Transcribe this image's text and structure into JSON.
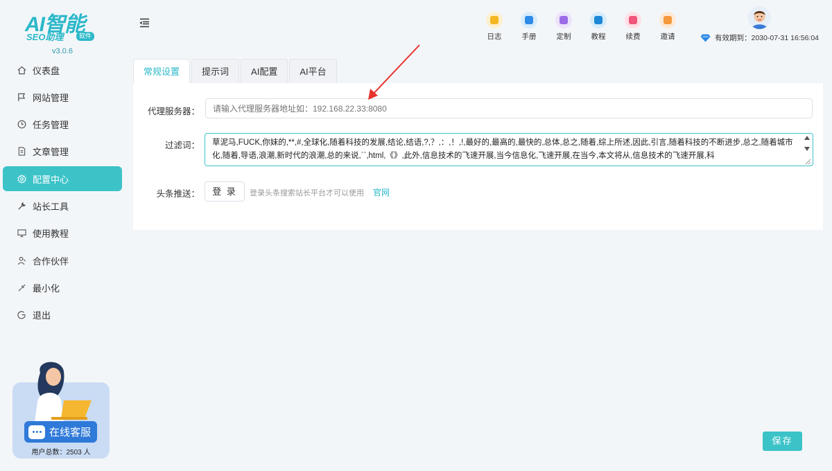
{
  "brand": {
    "logo_text": "AI智能",
    "logo_sub": "SEO助理",
    "logo_badge": "软件",
    "version": "v3.0.6"
  },
  "sidebar": {
    "items": [
      {
        "label": "仪表盘",
        "icon": "home-icon"
      },
      {
        "label": "网站管理",
        "icon": "flag-icon"
      },
      {
        "label": "任务管理",
        "icon": "clock-icon"
      },
      {
        "label": "文章管理",
        "icon": "document-icon"
      },
      {
        "label": "配置中心",
        "icon": "gear-icon",
        "active": true
      },
      {
        "label": "站长工具",
        "icon": "wrench-icon"
      },
      {
        "label": "使用教程",
        "icon": "monitor-icon"
      },
      {
        "label": "合作伙伴",
        "icon": "partner-icon"
      },
      {
        "label": "最小化",
        "icon": "minimize-icon"
      },
      {
        "label": "退出",
        "icon": "logout-icon"
      }
    ],
    "service_button": "在线客服",
    "user_count": "用户总数：2503 人"
  },
  "header": {
    "tools": [
      {
        "label": "日志",
        "icon": "log-icon",
        "bg": "#fdf0cf",
        "fg": "#f5b623"
      },
      {
        "label": "手册",
        "icon": "manual-icon",
        "bg": "#d9ecfb",
        "fg": "#2e8ae6"
      },
      {
        "label": "定制",
        "icon": "custom-icon",
        "bg": "#ece3fb",
        "fg": "#9b6be8"
      },
      {
        "label": "教程",
        "icon": "tutorial-icon",
        "bg": "#d7ecfb",
        "fg": "#1e88d8"
      },
      {
        "label": "续费",
        "icon": "renew-icon",
        "bg": "#fde0e6",
        "fg": "#f0557a"
      },
      {
        "label": "邀请",
        "icon": "invite-icon",
        "bg": "#fde9d6",
        "fg": "#f59a3c"
      }
    ],
    "expire_text": "有效期到：2030-07-31 16:56:04"
  },
  "tabs": [
    {
      "label": "常规设置",
      "active": true
    },
    {
      "label": "提示词"
    },
    {
      "label": "AI配置"
    },
    {
      "label": "AI平台"
    }
  ],
  "form": {
    "proxy_label": "代理服务器：",
    "proxy_placeholder": "请输入代理服务器地址如：192.168.22.33:8080",
    "filter_label": "过滤词：",
    "filter_value": "草泥马,FUCK,你妹的,**,#,全球化,随着科技的发展,结论,结语,?,？,：,！,!,最好的,最高的,最快的,总体,总之,随着,综上所述,因此,引言,随着科技的不断进步,总之,随着城市化,随着,导语,浪潮,新时代的浪潮,总的来说,``,html,《》,此外,信息技术的飞速开展,当今信息化,飞速开展,在当今,本文将从,信息技术的飞速开展,科",
    "toutiao_label": "头条推送：",
    "login_button": "登 录",
    "login_hint": "登录头条搜索站长平台才可以使用",
    "official_link": "官网"
  },
  "save_button": "保存",
  "colors": {
    "accent": "#3cc3c8",
    "link": "#2bb8c9",
    "service": "#2f7ad9"
  }
}
